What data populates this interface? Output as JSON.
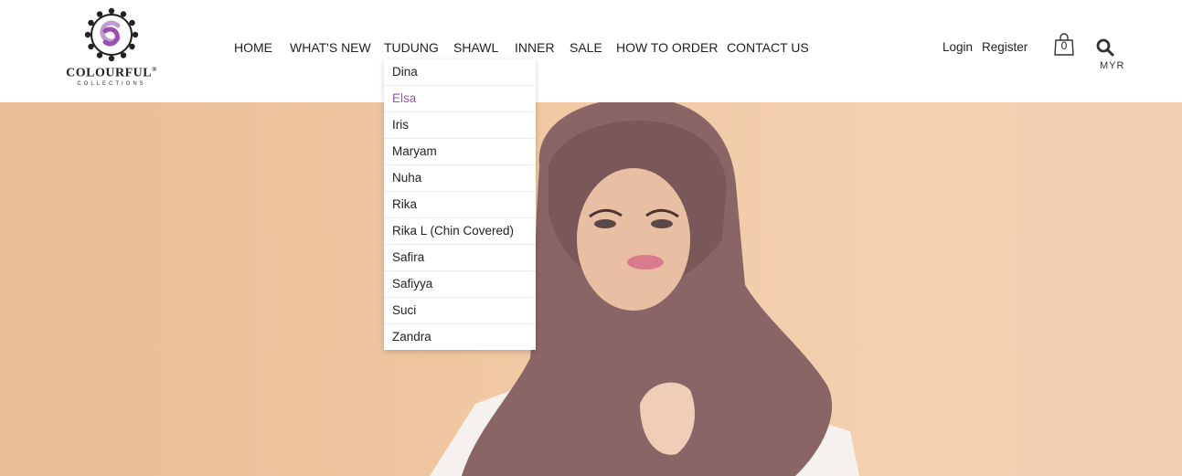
{
  "brand": {
    "name": "COLOURFUL",
    "mark": "®",
    "subline": "COLLECTIONS"
  },
  "nav": {
    "items": [
      {
        "label": "HOME"
      },
      {
        "label": "WHAT'S NEW"
      },
      {
        "label": "TUDUNG"
      },
      {
        "label": "SHAWL"
      },
      {
        "label": "INNER"
      },
      {
        "label": "SALE"
      },
      {
        "label": "HOW TO ORDER"
      },
      {
        "label": "CONTACT US"
      }
    ]
  },
  "account": {
    "login": "Login",
    "register": "Register"
  },
  "cart": {
    "count": "0"
  },
  "currency": "MYR",
  "dropdown": {
    "highlighted_color": "#a04ea9",
    "items": [
      {
        "label": "Dina"
      },
      {
        "label": "Elsa"
      },
      {
        "label": "Iris"
      },
      {
        "label": "Maryam"
      },
      {
        "label": "Nuha"
      },
      {
        "label": "Rika"
      },
      {
        "label": "Rika L (Chin Covered)"
      },
      {
        "label": "Safira"
      },
      {
        "label": "Safiyya"
      },
      {
        "label": "Suci"
      },
      {
        "label": "Zandra"
      }
    ]
  },
  "icons": [
    "logo-emblem-icon",
    "shopping-bag-icon",
    "search-icon"
  ]
}
